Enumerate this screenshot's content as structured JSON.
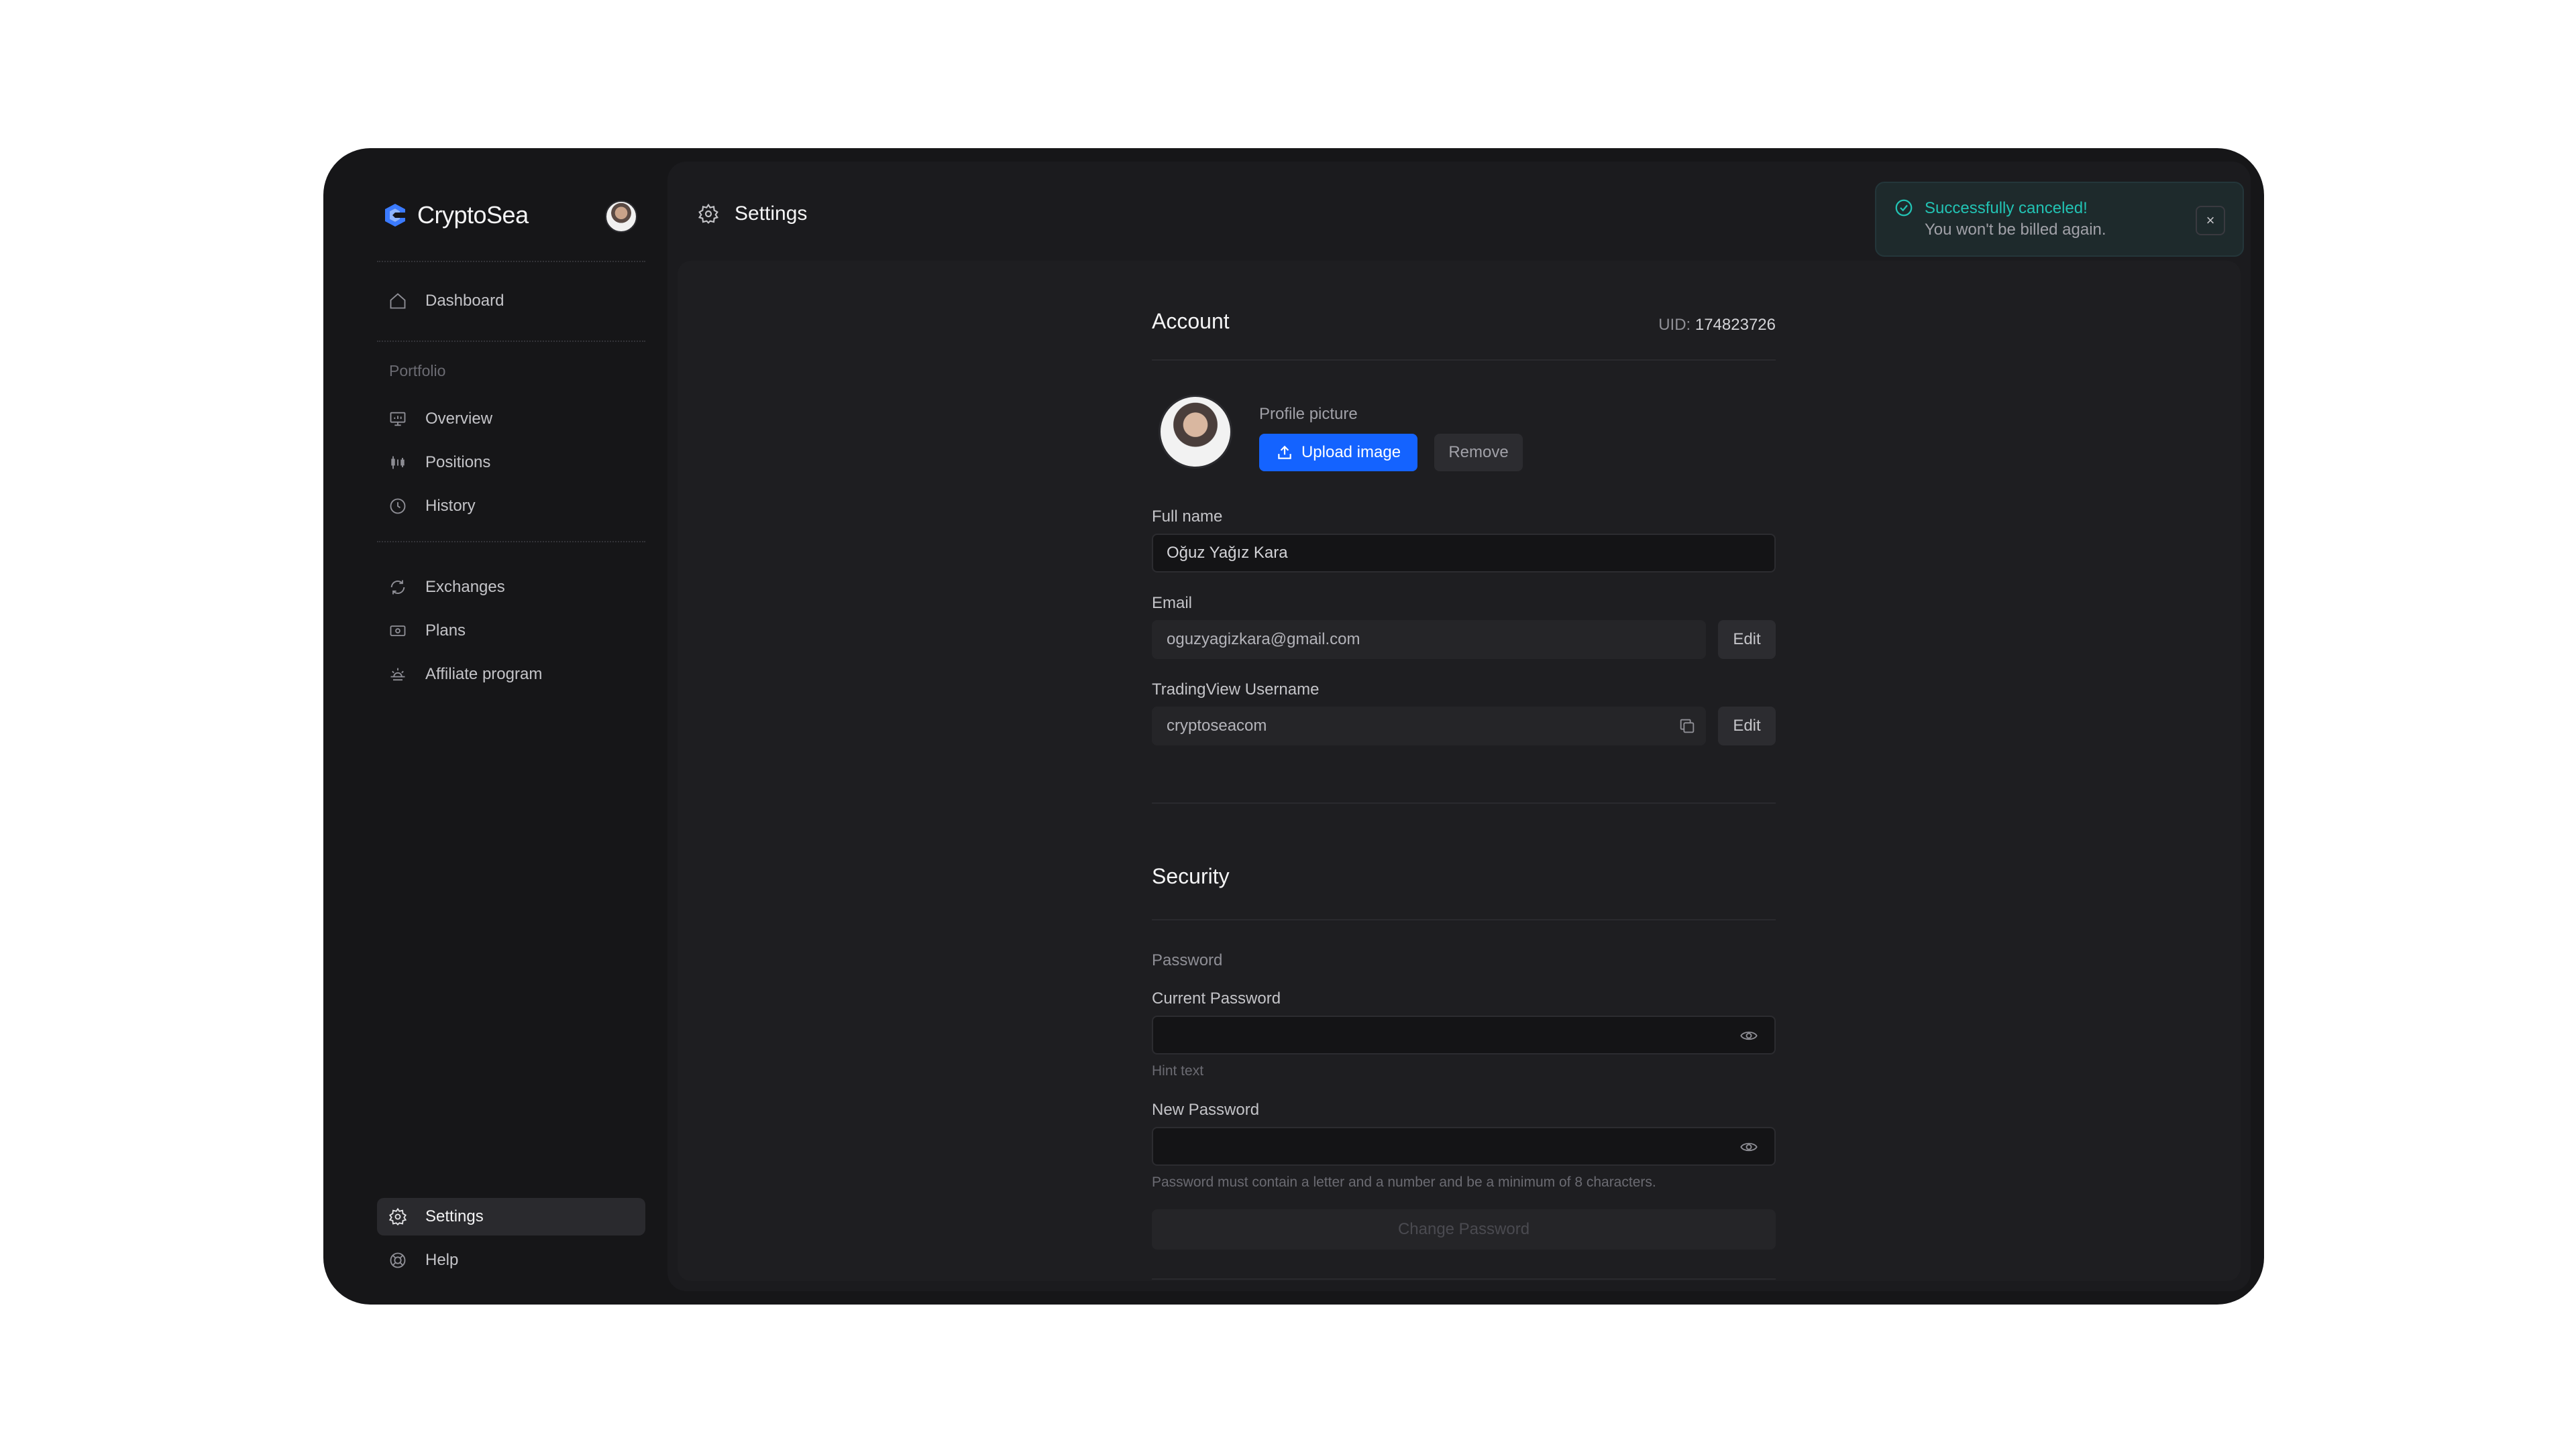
{
  "brand": {
    "name": "CryptoSea"
  },
  "sidebar": {
    "items": [
      {
        "label": "Dashboard",
        "icon": "home-icon"
      },
      {
        "label": "Overview",
        "icon": "presentation-icon"
      },
      {
        "label": "Positions",
        "icon": "candles-icon"
      },
      {
        "label": "History",
        "icon": "clock-icon"
      },
      {
        "label": "Exchanges",
        "icon": "refresh-icon"
      },
      {
        "label": "Plans",
        "icon": "money-icon"
      },
      {
        "label": "Affiliate program",
        "icon": "sunset-icon"
      },
      {
        "label": "Settings",
        "icon": "gear-icon"
      },
      {
        "label": "Help",
        "icon": "lifebuoy-icon"
      }
    ],
    "portfolio_label": "Portfolio"
  },
  "header": {
    "title": "Settings"
  },
  "account": {
    "title": "Account",
    "uid_label": "UID:",
    "uid_value": "174823726",
    "profile_picture_label": "Profile picture",
    "upload_label": "Upload image",
    "remove_label": "Remove",
    "full_name_label": "Full name",
    "full_name_value": "Oğuz Yağız Kara",
    "email_label": "Email",
    "email_value": "oguzyagizkara@gmail.com",
    "edit_label": "Edit",
    "tv_label": "TradingView Username",
    "tv_value": "cryptoseacom"
  },
  "security": {
    "title": "Security",
    "password_section": "Password",
    "current_label": "Current Password",
    "current_hint": "Hint text",
    "new_label": "New Password",
    "new_hint": "Password must contain a letter and a number and be a minimum of 8 characters.",
    "change_label": "Change Password"
  },
  "toast": {
    "title": "Successfully canceled!",
    "message": "You won't be billed again.",
    "close": "×"
  },
  "colors": {
    "accent": "#1463ff",
    "success": "#22c3b4",
    "background": "#161618"
  }
}
